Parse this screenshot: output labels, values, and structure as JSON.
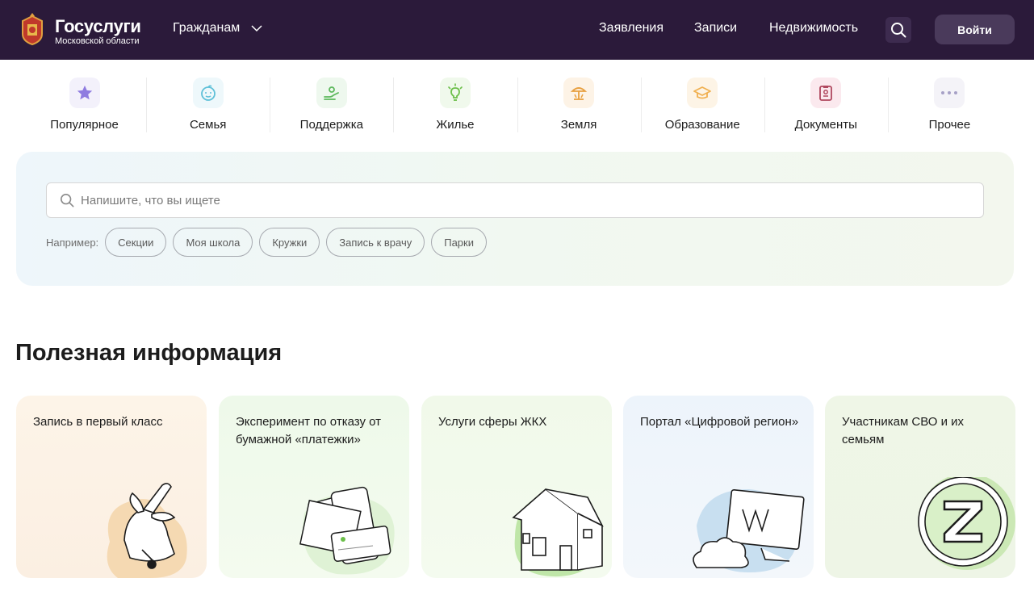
{
  "header": {
    "logo_title": "Госуслуги",
    "logo_subtitle": "Московской области",
    "audience_label": "Гражданам",
    "nav": [
      "Заявления",
      "Записи",
      "Недвижимость"
    ],
    "login_label": "Войти",
    "background_color": "#2b1a3a"
  },
  "categories": [
    {
      "label": "Популярное",
      "icon": "star-icon"
    },
    {
      "label": "Семья",
      "icon": "baby-face-icon"
    },
    {
      "label": "Поддержка",
      "icon": "helping-hand-icon"
    },
    {
      "label": "Жилье",
      "icon": "lightbulb-icon"
    },
    {
      "label": "Земля",
      "icon": "land-icon"
    },
    {
      "label": "Образование",
      "icon": "graduation-cap-icon"
    },
    {
      "label": "Документы",
      "icon": "document-icon"
    },
    {
      "label": "Прочее",
      "icon": "more-dots-icon"
    }
  ],
  "search": {
    "placeholder": "Напишите, что вы ищете",
    "examples_label": "Например:",
    "examples": [
      "Секции",
      "Моя школа",
      "Кружки",
      "Запись к врачу",
      "Парки"
    ]
  },
  "useful": {
    "title": "Полезная информация",
    "cards": [
      {
        "title": "Запись в первый класс",
        "icon": "school-bell-icon",
        "bg": "#fdf4e8"
      },
      {
        "title": "Эксперимент по отказу от бумажной «платежки»",
        "icon": "receipt-phone-icon",
        "bg": "#eef8e9"
      },
      {
        "title": "Услуги сферы ЖКХ",
        "icon": "house-icon",
        "bg": "#f1f9ea"
      },
      {
        "title": "Портал «Цифровой регион»",
        "icon": "monitor-cloud-icon",
        "bg": "#edf4fb"
      },
      {
        "title": "Участникам СВО и их семьям",
        "icon": "z-medal-icon",
        "bg": "#eef5e6"
      }
    ]
  }
}
